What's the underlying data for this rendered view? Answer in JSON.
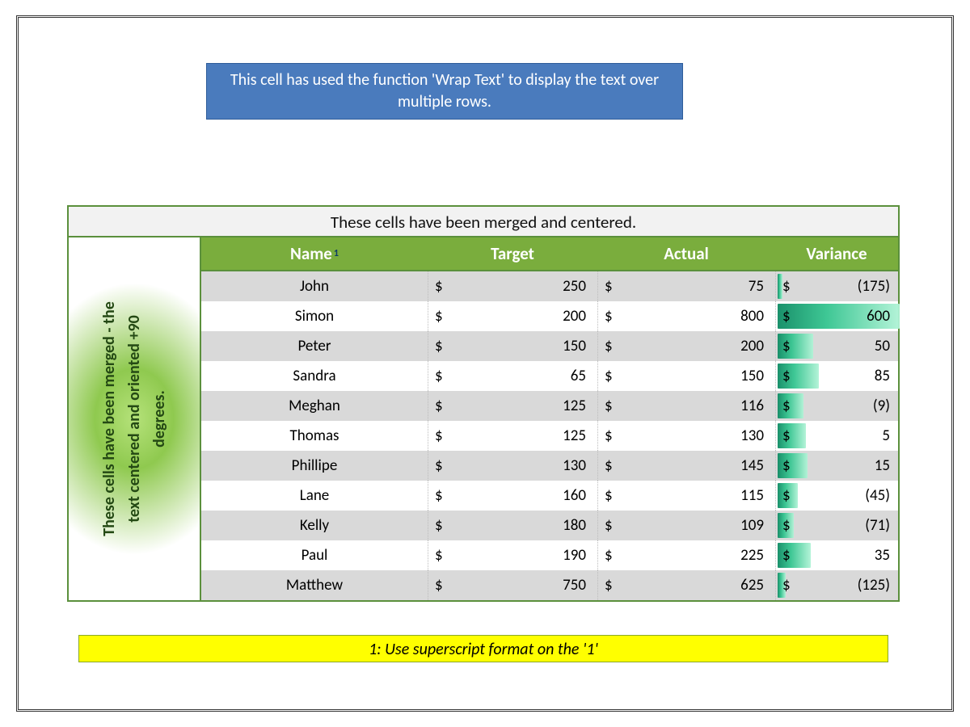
{
  "wrap_text_banner": "This cell has used the function 'Wrap Text' to display the text over multiple rows.",
  "side_rotated_text": "These cells have been merged - the\ntext centered and oriented +90\ndegrees.",
  "merge_banner": "These cells have been merged and centered.",
  "headers": {
    "name": "Name",
    "name_super": "1",
    "target": "Target",
    "actual": "Actual",
    "variance": "Variance"
  },
  "currency_symbol": "$",
  "rows": [
    {
      "name": "John",
      "target": 250,
      "actual": 75,
      "variance": -175
    },
    {
      "name": "Simon",
      "target": 200,
      "actual": 800,
      "variance": 600
    },
    {
      "name": "Peter",
      "target": 150,
      "actual": 200,
      "variance": 50
    },
    {
      "name": "Sandra",
      "target": 65,
      "actual": 150,
      "variance": 85
    },
    {
      "name": "Meghan",
      "target": 125,
      "actual": 116,
      "variance": -9
    },
    {
      "name": "Thomas",
      "target": 125,
      "actual": 130,
      "variance": 5
    },
    {
      "name": "Phillipe",
      "target": 130,
      "actual": 145,
      "variance": 15
    },
    {
      "name": "Lane",
      "target": 160,
      "actual": 115,
      "variance": -45
    },
    {
      "name": "Kelly",
      "target": 180,
      "actual": 109,
      "variance": -71
    },
    {
      "name": "Paul",
      "target": 190,
      "actual": 225,
      "variance": 35
    },
    {
      "name": "Matthew",
      "target": 750,
      "actual": 625,
      "variance": -125
    }
  ],
  "footnote": "1: Use superscript format on the '1'",
  "databar": {
    "min": -175,
    "max": 600
  },
  "chart_data": {
    "type": "table",
    "title": "Target vs Actual with Variance (data bars on Variance)",
    "columns": [
      "Name",
      "Target",
      "Actual",
      "Variance"
    ],
    "series": [
      {
        "name": "Target",
        "values": [
          250,
          200,
          150,
          65,
          125,
          125,
          130,
          160,
          180,
          190,
          750
        ]
      },
      {
        "name": "Actual",
        "values": [
          75,
          800,
          200,
          150,
          116,
          130,
          145,
          115,
          109,
          225,
          625
        ]
      },
      {
        "name": "Variance",
        "values": [
          -175,
          600,
          50,
          85,
          -9,
          5,
          15,
          -45,
          -71,
          35,
          -125
        ]
      }
    ],
    "categories": [
      "John",
      "Simon",
      "Peter",
      "Sandra",
      "Meghan",
      "Thomas",
      "Phillipe",
      "Lane",
      "Kelly",
      "Paul",
      "Matthew"
    ]
  }
}
